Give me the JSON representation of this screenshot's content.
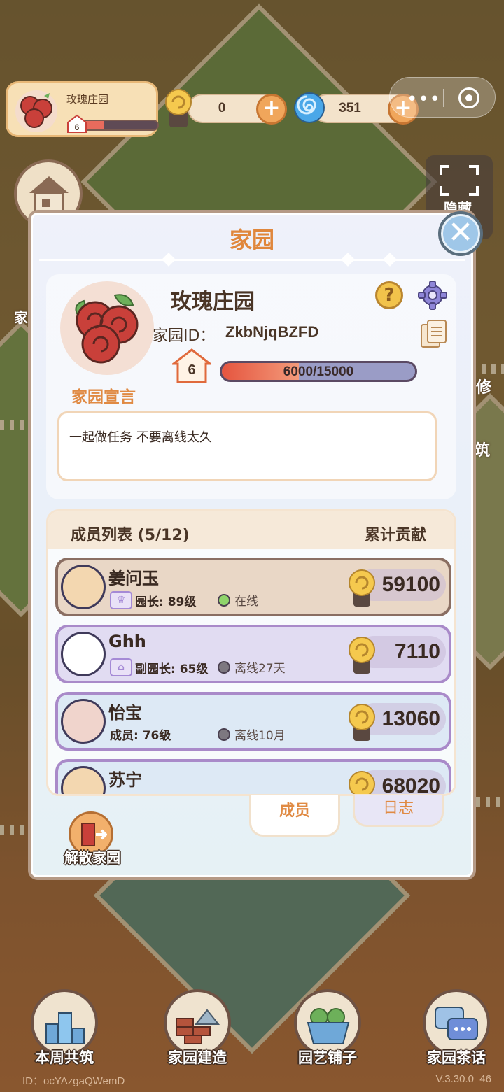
{
  "hud": {
    "home_name": "玫瑰庄园",
    "home_level": "6",
    "home_level_progress": 0.4,
    "snail_coins": "0",
    "spiral_gems": "351"
  },
  "side": {
    "hide_label": "隐藏",
    "left_partial": "家",
    "right_partial_1": "修",
    "right_partial_2": "筑"
  },
  "dialog": {
    "title": "家园",
    "home_name": "玫瑰庄园",
    "home_id_label": "家园ID：",
    "home_id_value": "ZkbNjqBZFD",
    "level": "6",
    "exp_text": "6000/15000",
    "exp_current": 6000,
    "exp_max": 15000,
    "declaration_title": "家园宣言",
    "declaration_text": "一起做任务  不要离线太久",
    "members_title": "成员列表 (5/12)",
    "contribution_title": "累计贡献",
    "members": [
      {
        "name": "姜问玉",
        "role": "园长: 89级",
        "status": "在线",
        "status_color": "#8fd46b",
        "contribution": "59100"
      },
      {
        "name": "Ghh",
        "role": "副园长: 65级",
        "status": "离线27天",
        "status_color": "#7d7880",
        "contribution": "7110"
      },
      {
        "name": "怡宝",
        "role": "成员: 76级",
        "status": "离线10月",
        "status_color": "#7d7880",
        "contribution": "13060"
      },
      {
        "name": "苏宁",
        "role": "",
        "status": "",
        "status_color": "#7d7880",
        "contribution": "68020"
      }
    ],
    "tabs": {
      "members": "成员",
      "log": "日志"
    },
    "dissolve_label": "解散家园"
  },
  "nav": {
    "weekly_build": "本周共筑",
    "home_build": "家园建造",
    "garden_shop": "园艺铺子",
    "home_tea": "家园茶话"
  },
  "footer": {
    "id": "ID：ocYAzgaQWemD",
    "version": "V.3.30.0_46"
  },
  "colors": {
    "accent_orange": "#e08a43",
    "online_green": "#8fd46b",
    "leader_card": "#e9d7c6",
    "vice_card": "#e1dcf2",
    "member_card": "#dde9f5"
  }
}
